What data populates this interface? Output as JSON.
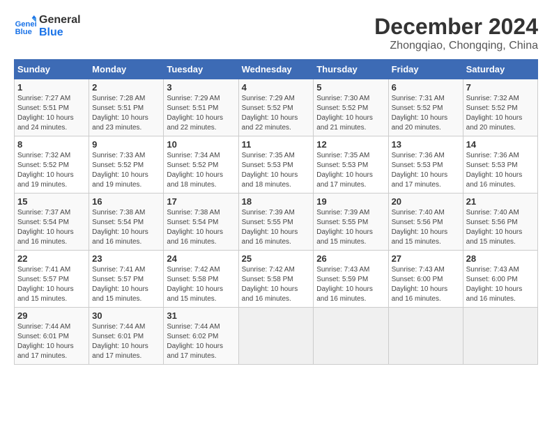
{
  "logo": {
    "line1": "General",
    "line2": "Blue"
  },
  "title": "December 2024",
  "location": "Zhongqiao, Chongqing, China",
  "days_of_week": [
    "Sunday",
    "Monday",
    "Tuesday",
    "Wednesday",
    "Thursday",
    "Friday",
    "Saturday"
  ],
  "weeks": [
    [
      {
        "day": 1,
        "sunrise": "7:27 AM",
        "sunset": "5:51 PM",
        "daylight": "10 hours and 24 minutes."
      },
      {
        "day": 2,
        "sunrise": "7:28 AM",
        "sunset": "5:51 PM",
        "daylight": "10 hours and 23 minutes."
      },
      {
        "day": 3,
        "sunrise": "7:29 AM",
        "sunset": "5:51 PM",
        "daylight": "10 hours and 22 minutes."
      },
      {
        "day": 4,
        "sunrise": "7:29 AM",
        "sunset": "5:52 PM",
        "daylight": "10 hours and 22 minutes."
      },
      {
        "day": 5,
        "sunrise": "7:30 AM",
        "sunset": "5:52 PM",
        "daylight": "10 hours and 21 minutes."
      },
      {
        "day": 6,
        "sunrise": "7:31 AM",
        "sunset": "5:52 PM",
        "daylight": "10 hours and 20 minutes."
      },
      {
        "day": 7,
        "sunrise": "7:32 AM",
        "sunset": "5:52 PM",
        "daylight": "10 hours and 20 minutes."
      }
    ],
    [
      {
        "day": 8,
        "sunrise": "7:32 AM",
        "sunset": "5:52 PM",
        "daylight": "10 hours and 19 minutes."
      },
      {
        "day": 9,
        "sunrise": "7:33 AM",
        "sunset": "5:52 PM",
        "daylight": "10 hours and 19 minutes."
      },
      {
        "day": 10,
        "sunrise": "7:34 AM",
        "sunset": "5:52 PM",
        "daylight": "10 hours and 18 minutes."
      },
      {
        "day": 11,
        "sunrise": "7:35 AM",
        "sunset": "5:53 PM",
        "daylight": "10 hours and 18 minutes."
      },
      {
        "day": 12,
        "sunrise": "7:35 AM",
        "sunset": "5:53 PM",
        "daylight": "10 hours and 17 minutes."
      },
      {
        "day": 13,
        "sunrise": "7:36 AM",
        "sunset": "5:53 PM",
        "daylight": "10 hours and 17 minutes."
      },
      {
        "day": 14,
        "sunrise": "7:36 AM",
        "sunset": "5:53 PM",
        "daylight": "10 hours and 16 minutes."
      }
    ],
    [
      {
        "day": 15,
        "sunrise": "7:37 AM",
        "sunset": "5:54 PM",
        "daylight": "10 hours and 16 minutes."
      },
      {
        "day": 16,
        "sunrise": "7:38 AM",
        "sunset": "5:54 PM",
        "daylight": "10 hours and 16 minutes."
      },
      {
        "day": 17,
        "sunrise": "7:38 AM",
        "sunset": "5:54 PM",
        "daylight": "10 hours and 16 minutes."
      },
      {
        "day": 18,
        "sunrise": "7:39 AM",
        "sunset": "5:55 PM",
        "daylight": "10 hours and 16 minutes."
      },
      {
        "day": 19,
        "sunrise": "7:39 AM",
        "sunset": "5:55 PM",
        "daylight": "10 hours and 15 minutes."
      },
      {
        "day": 20,
        "sunrise": "7:40 AM",
        "sunset": "5:56 PM",
        "daylight": "10 hours and 15 minutes."
      },
      {
        "day": 21,
        "sunrise": "7:40 AM",
        "sunset": "5:56 PM",
        "daylight": "10 hours and 15 minutes."
      }
    ],
    [
      {
        "day": 22,
        "sunrise": "7:41 AM",
        "sunset": "5:57 PM",
        "daylight": "10 hours and 15 minutes."
      },
      {
        "day": 23,
        "sunrise": "7:41 AM",
        "sunset": "5:57 PM",
        "daylight": "10 hours and 15 minutes."
      },
      {
        "day": 24,
        "sunrise": "7:42 AM",
        "sunset": "5:58 PM",
        "daylight": "10 hours and 15 minutes."
      },
      {
        "day": 25,
        "sunrise": "7:42 AM",
        "sunset": "5:58 PM",
        "daylight": "10 hours and 16 minutes."
      },
      {
        "day": 26,
        "sunrise": "7:43 AM",
        "sunset": "5:59 PM",
        "daylight": "10 hours and 16 minutes."
      },
      {
        "day": 27,
        "sunrise": "7:43 AM",
        "sunset": "6:00 PM",
        "daylight": "10 hours and 16 minutes."
      },
      {
        "day": 28,
        "sunrise": "7:43 AM",
        "sunset": "6:00 PM",
        "daylight": "10 hours and 16 minutes."
      }
    ],
    [
      {
        "day": 29,
        "sunrise": "7:44 AM",
        "sunset": "6:01 PM",
        "daylight": "10 hours and 17 minutes."
      },
      {
        "day": 30,
        "sunrise": "7:44 AM",
        "sunset": "6:01 PM",
        "daylight": "10 hours and 17 minutes."
      },
      {
        "day": 31,
        "sunrise": "7:44 AM",
        "sunset": "6:02 PM",
        "daylight": "10 hours and 17 minutes."
      },
      null,
      null,
      null,
      null
    ]
  ]
}
